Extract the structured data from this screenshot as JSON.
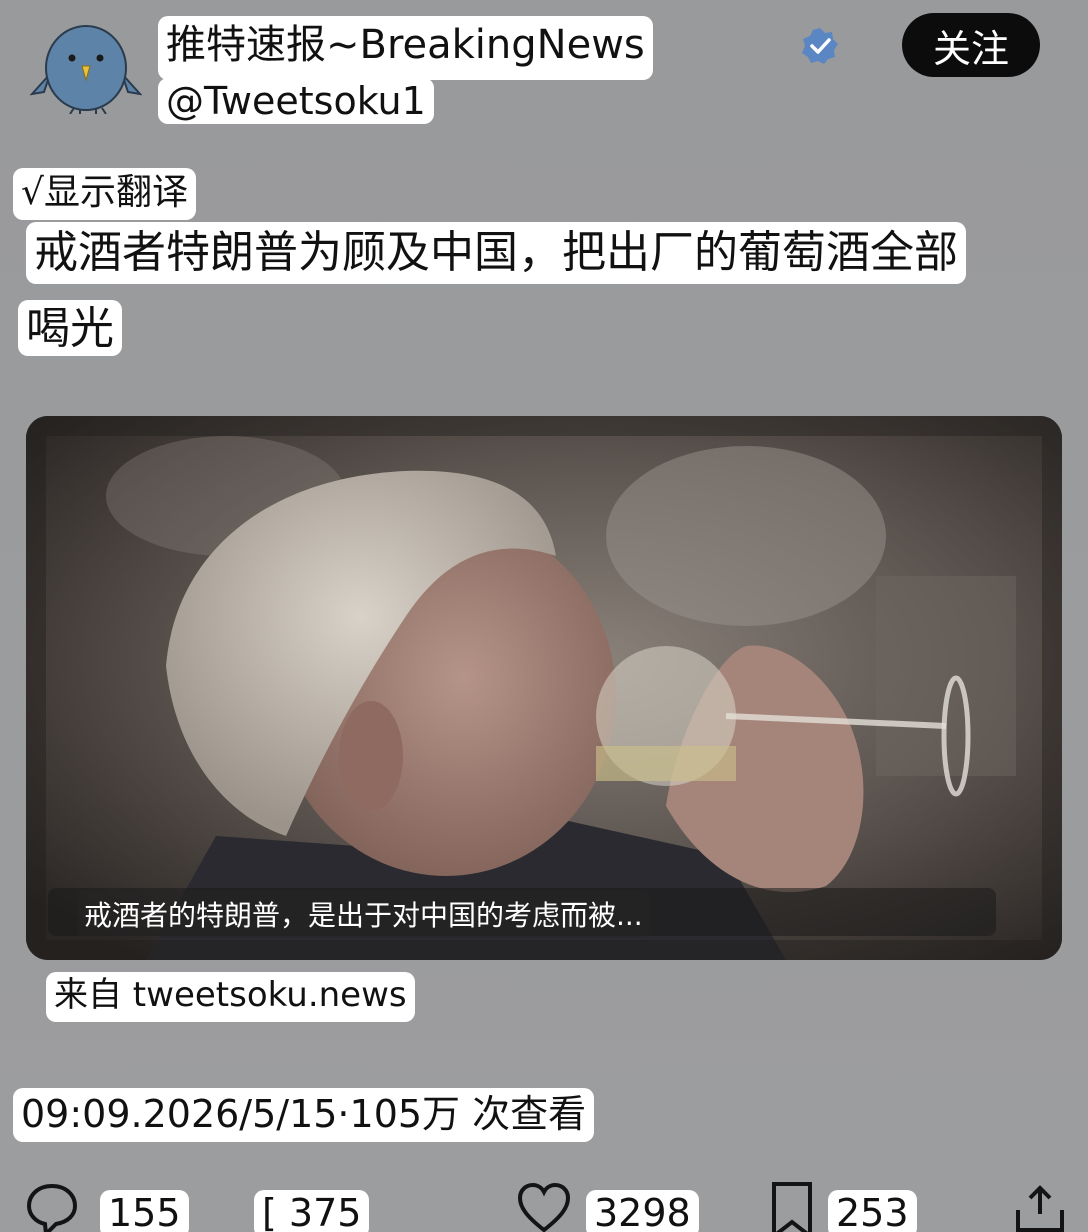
{
  "header": {
    "display_name": "推特速报~BreakingNews",
    "handle": "@Tweetsoku1",
    "follow_label": "关注",
    "avatar_icon": "blue-bird-avatar",
    "verified_icon": "verified-badge-icon"
  },
  "post": {
    "translate_label": "√显示翻译",
    "text_line1": "戒酒者特朗普为顾及中国，把出厂的葡萄酒全部",
    "text_line2": "喝光",
    "media_subtitle": "戒酒者的特朗普，是出于对中国的考虑而被...",
    "source": "来自 tweetsoku.news",
    "meta": "09:09.2026/5/15·105万 次查看"
  },
  "actions": {
    "comments": "155",
    "retweets": "[ 375",
    "likes": "3298",
    "bookmarks": "253"
  },
  "colors": {
    "background": "#9a9b9d",
    "highlight": "#ffffff",
    "follow_button": "#0c0c0c",
    "avatar_blue": "#5e83a8",
    "verified_blue": "#5b86c4"
  }
}
